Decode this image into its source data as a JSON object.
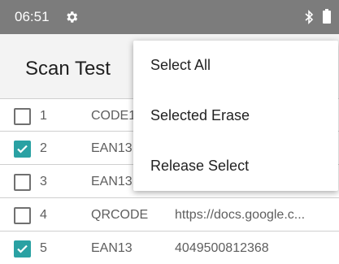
{
  "status_bar": {
    "time": "06:51",
    "icons": [
      "gear-icon",
      "bluetooth-icon",
      "battery-icon"
    ]
  },
  "app_bar": {
    "title": "Scan Test"
  },
  "list": {
    "rows": [
      {
        "checked": false,
        "index": "1",
        "type": "CODE1",
        "data": ""
      },
      {
        "checked": true,
        "index": "2",
        "type": "EAN13",
        "data": ""
      },
      {
        "checked": false,
        "index": "3",
        "type": "EAN13",
        "data": ""
      },
      {
        "checked": false,
        "index": "4",
        "type": "QRCODE",
        "data": "https://docs.google.c..."
      },
      {
        "checked": true,
        "index": "5",
        "type": "EAN13",
        "data": "4049500812368"
      }
    ]
  },
  "menu": {
    "items": [
      "Select All",
      "Selected Erase",
      "Release Select"
    ]
  },
  "colors": {
    "status_bar": "#7c7c7c",
    "app_bar": "#f3f3f3",
    "checkbox_checked": "#2aa1a3"
  }
}
